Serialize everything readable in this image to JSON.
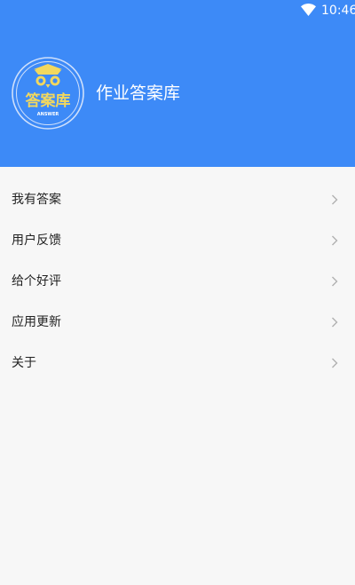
{
  "status_bar": {
    "time": "10:46",
    "icon": "wifi-icon"
  },
  "header": {
    "title": "作业答案库",
    "logo": {
      "text": "答案库",
      "subtext": "ANSWER",
      "icon": "owl-icon"
    }
  },
  "menu": {
    "items": [
      {
        "label": "我有答案",
        "icon": "chevron-right-icon"
      },
      {
        "label": "用户反馈",
        "icon": "chevron-right-icon"
      },
      {
        "label": "给个好评",
        "icon": "chevron-right-icon"
      },
      {
        "label": "应用更新",
        "icon": "chevron-right-icon"
      },
      {
        "label": "关于",
        "icon": "chevron-right-icon"
      }
    ]
  },
  "colors": {
    "header_background": "#3d8af7",
    "page_background": "#f7f7f7",
    "logo_yellow": "#f2d85e",
    "logo_ring": "#cfe0fb",
    "chevron": "#b0b0b0"
  }
}
